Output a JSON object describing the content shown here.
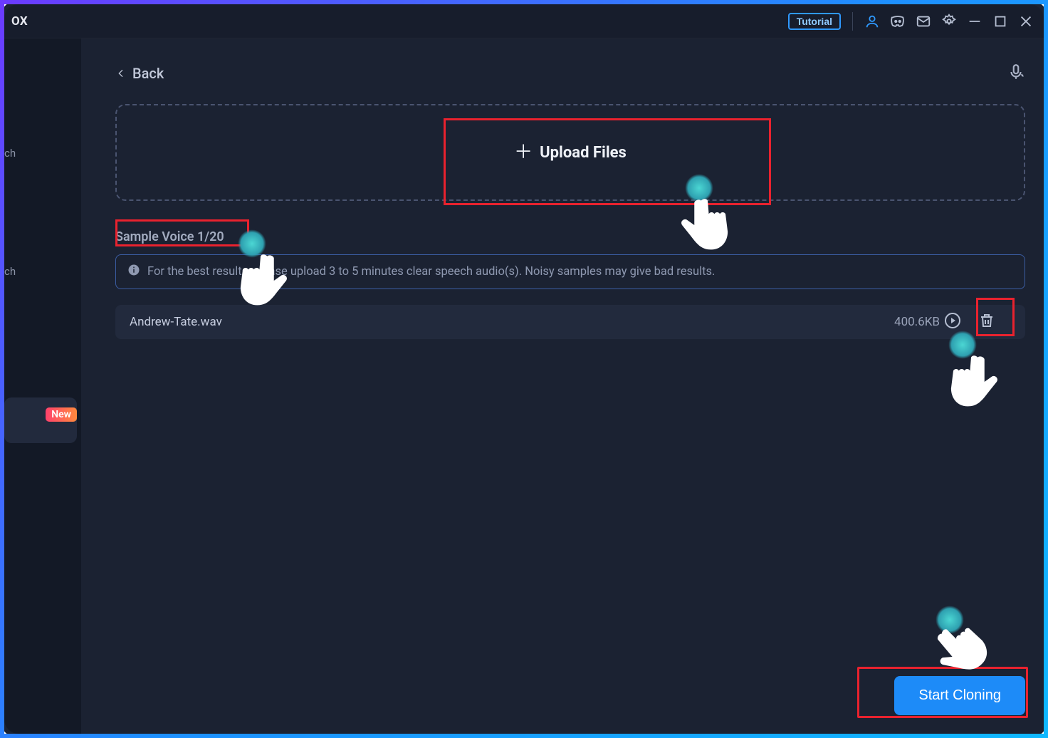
{
  "titlebar": {
    "app_fragment": "OX",
    "tutorial_label": "Tutorial"
  },
  "sidebar": {
    "items": [
      "ch",
      "ch"
    ],
    "new_label": "New"
  },
  "back_label": "Back",
  "upload_label": "Upload Files",
  "section_title": "Sample Voice 1/20",
  "notice_text": "For the best results, please upload 3 to 5 minutes clear speech audio(s). Noisy samples may give bad results.",
  "file": {
    "name": "Andrew-Tate.wav",
    "size": "400.6KB"
  },
  "start_label": "Start Cloning"
}
